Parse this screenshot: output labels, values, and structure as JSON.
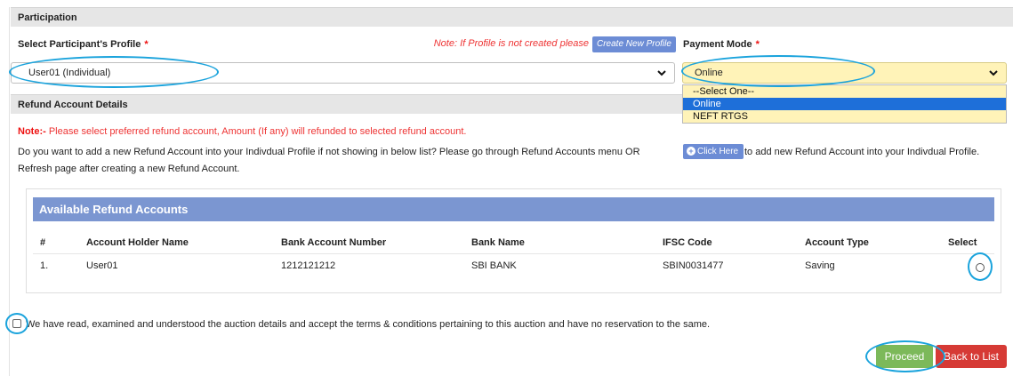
{
  "participation": {
    "section_title": "Participation",
    "profile_label": "Select Participant's Profile",
    "required_mark": "*",
    "profile_note": "Note: If Profile is not created please",
    "create_profile_button": "Create New Profile",
    "profile_value": "User01 (Individual)",
    "payment_label": "Payment Mode",
    "payment_value": "Online",
    "payment_options": [
      "--Select One--",
      "Online",
      "NEFT RTGS"
    ],
    "payment_selected_index": 1
  },
  "refund": {
    "section_title": "Refund Account Details",
    "note_prefix": "Note:-",
    "note_text": " Please select preferred refund account, Amount (If any) will refunded to selected refund account.",
    "info_part1": "Do you want to add a new Refund Account into your Indivdual Profile if not showing in below list? Please go through Refund Accounts menu OR",
    "click_here_button": "Click Here",
    "info_part2": "to add new Refund Account into your Indivdual Profile.",
    "info_line2": "Refresh page after creating a new Refund Account."
  },
  "accounts_table": {
    "title": "Available Refund Accounts",
    "columns": [
      "#",
      "Account Holder Name",
      "Bank Account Number",
      "Bank Name",
      "IFSC Code",
      "Account Type",
      "Select"
    ],
    "rows": [
      [
        "1.",
        "User01",
        "1212121212",
        "SBI BANK",
        "SBIN0031477",
        "Saving"
      ]
    ]
  },
  "terms_text": "We have read, examined and understood the auction details and accept the terms & conditions pertaining to this auction and have no reservation to the same.",
  "actions": {
    "proceed": "Proceed",
    "back": "Back to List"
  },
  "colors": {
    "accent_blue": "#6c8cd5",
    "table_header": "#7b96d1",
    "proceed_green": "#7cb95a",
    "back_red": "#d63a35",
    "highlight_ring": "#1aa3dc",
    "dropdown_bg": "#fff3b8"
  }
}
